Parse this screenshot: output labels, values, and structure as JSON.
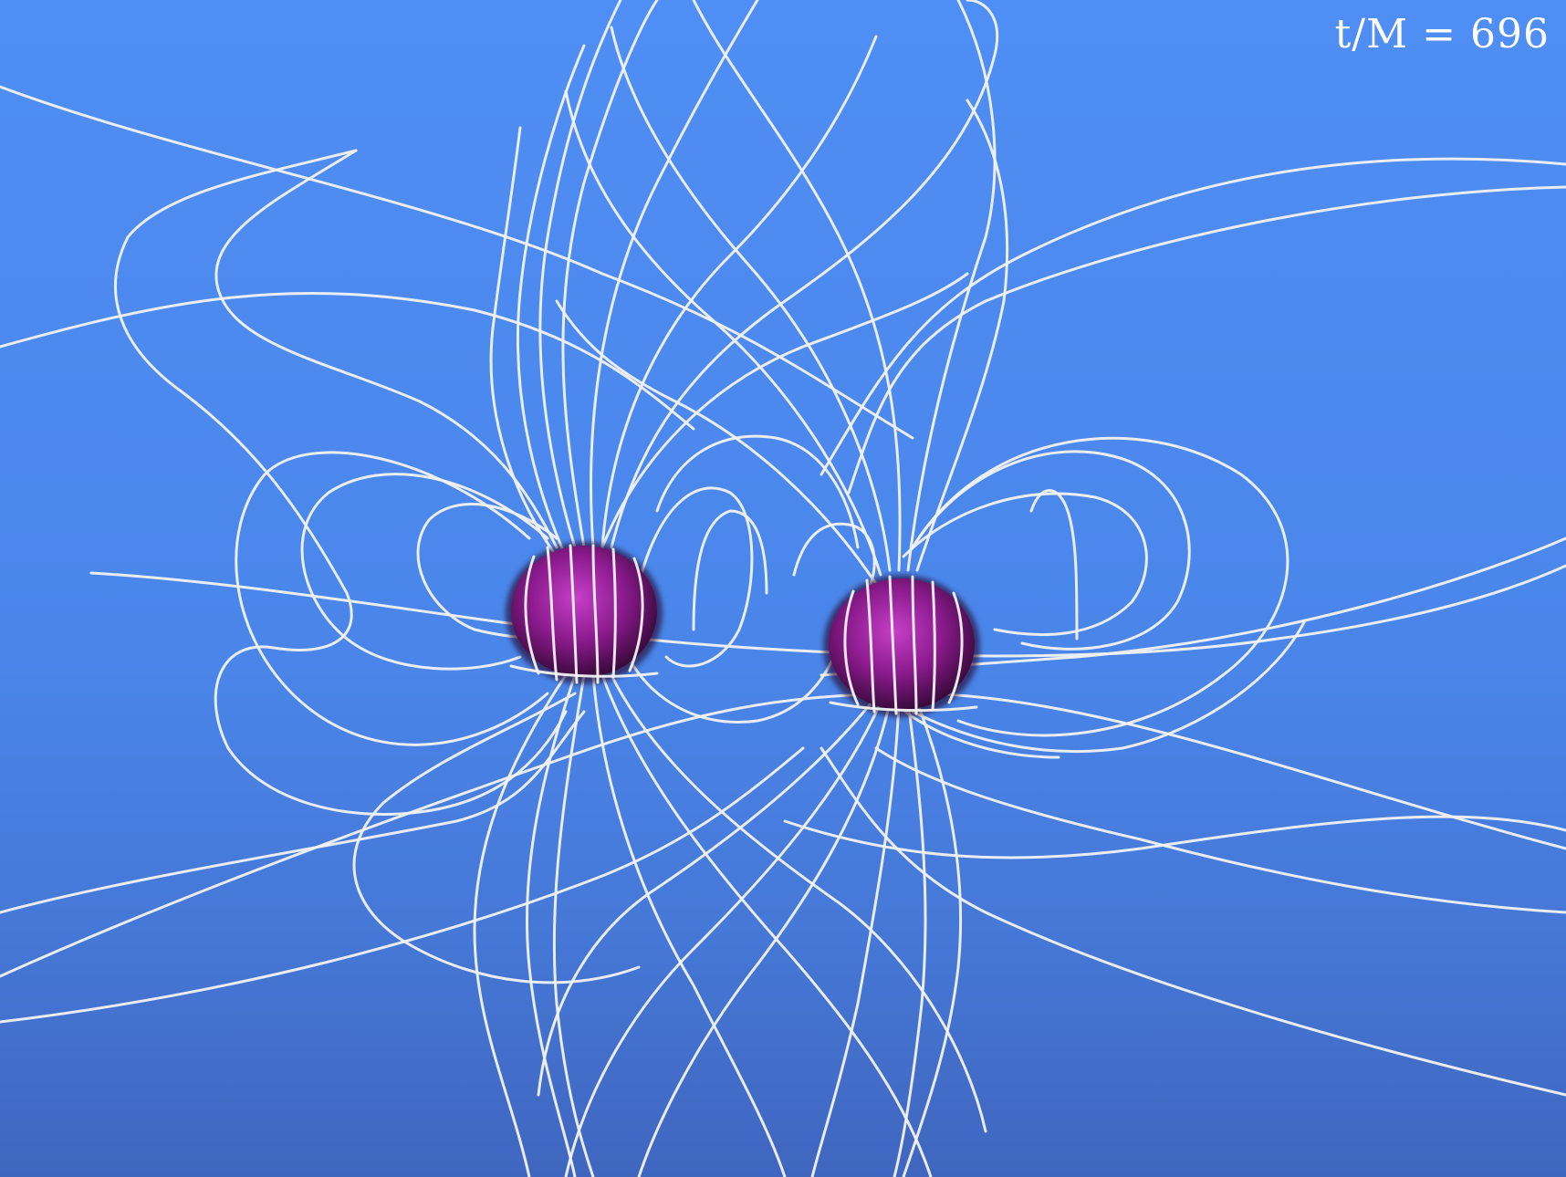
{
  "time_label": "t/M = 696",
  "colors": {
    "background": "#4a86ea",
    "field_lines": "#f2f2f2",
    "black_hole": "#8a1a8c"
  },
  "objects": [
    {
      "name": "left-black-hole"
    },
    {
      "name": "right-black-hole"
    }
  ]
}
